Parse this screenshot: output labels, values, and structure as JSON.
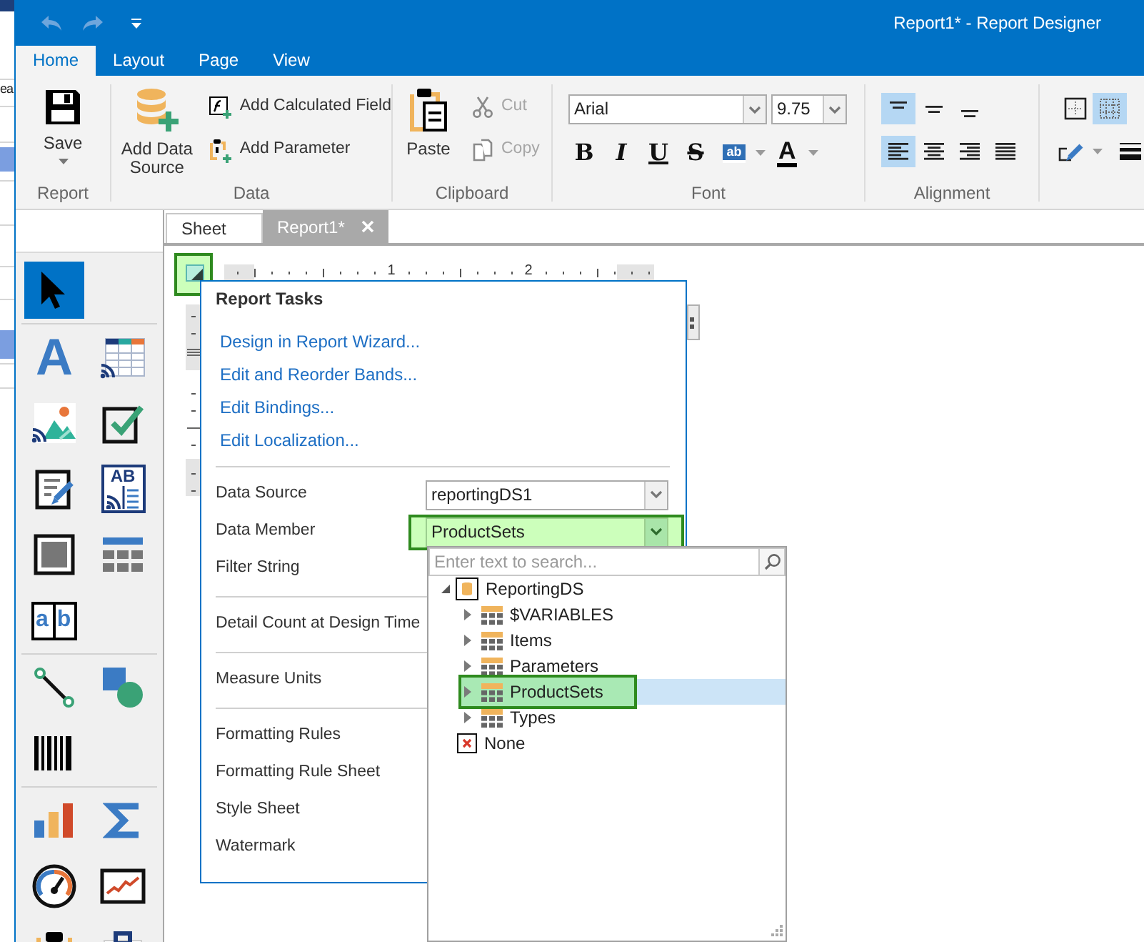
{
  "background_window": {
    "text": "ea"
  },
  "window": {
    "title": "Report1* - Report Designer"
  },
  "quick_access": [
    {
      "kind": "undo",
      "disabled": true
    },
    {
      "kind": "redo",
      "disabled": true
    },
    {
      "kind": "customize",
      "disabled": false
    }
  ],
  "ribbon_tabs": [
    {
      "label": "Home",
      "selected": true
    },
    {
      "label": "Layout",
      "selected": false
    },
    {
      "label": "Page",
      "selected": false
    },
    {
      "label": "View",
      "selected": false
    }
  ],
  "ribbon_groups": [
    {
      "kind": "commands",
      "label": "Report",
      "large": [
        {
          "kind": "save",
          "label": "Save",
          "dropdown": true
        }
      ]
    },
    {
      "kind": "commands",
      "label": "Data",
      "large": [
        {
          "kind": "datasource",
          "label": "Add Data Source",
          "dropdown": false
        }
      ],
      "small": [
        {
          "kind": "function",
          "label": "Add Calculated Field",
          "disabled": false
        },
        {
          "kind": "parameter",
          "label": "Add Parameter",
          "disabled": false
        }
      ]
    },
    {
      "kind": "commands",
      "label": "Clipboard",
      "large": [
        {
          "kind": "paste",
          "label": "Paste",
          "dropdown": false
        }
      ],
      "small": [
        {
          "kind": "cut",
          "label": "Cut",
          "disabled": true
        },
        {
          "kind": "copy",
          "label": "Copy",
          "disabled": true
        }
      ]
    },
    {
      "kind": "font",
      "label": "Font",
      "font_name": "Arial",
      "font_size": "9.75",
      "styles": [
        {
          "label": "B",
          "selected": false
        },
        {
          "label": "I",
          "selected": false
        },
        {
          "label": "U",
          "selected": false
        },
        {
          "label": "S",
          "selected": false
        }
      ],
      "highlight_color": {
        "label": "ab"
      },
      "font_color": {
        "label": "A"
      }
    },
    {
      "kind": "alignment",
      "label": "Alignment",
      "vertical": [
        {
          "selected": true
        },
        {
          "selected": false
        },
        {
          "selected": false
        }
      ],
      "horizontal": [
        {
          "selected": true
        },
        {
          "selected": false
        },
        {
          "selected": false
        },
        {
          "selected": false
        }
      ]
    },
    {
      "kind": "borders",
      "buttons": [
        {
          "selected": false
        },
        {
          "selected": true
        }
      ]
    }
  ],
  "toolbox": {
    "sections": [
      {
        "tools": [
          {
            "kind": "pointer",
            "selected": true
          }
        ]
      },
      {
        "tools": [
          {
            "kind": "label",
            "glyph": "A",
            "selected": false
          },
          {
            "kind": "table",
            "selected": false
          },
          {
            "kind": "picture",
            "selected": false
          },
          {
            "kind": "checkbox",
            "selected": false
          },
          {
            "kind": "richtext",
            "selected": false
          },
          {
            "kind": "columns",
            "glyph": "AB",
            "selected": false
          },
          {
            "kind": "panel",
            "selected": false
          },
          {
            "kind": "grid",
            "selected": false
          },
          {
            "kind": "charcomb",
            "glyph": "ab",
            "selected": false
          }
        ]
      },
      {
        "tools": [
          {
            "kind": "line",
            "selected": false
          },
          {
            "kind": "shape",
            "selected": false
          },
          {
            "kind": "barcode",
            "selected": false
          }
        ]
      },
      {
        "tools": [
          {
            "kind": "chart",
            "selected": false
          },
          {
            "kind": "summary",
            "selected": false
          },
          {
            "kind": "gauge",
            "selected": false
          },
          {
            "kind": "sparkline",
            "selected": false
          },
          {
            "kind": "clipboard",
            "selected": false
          },
          {
            "kind": "case",
            "selected": false
          }
        ]
      }
    ]
  },
  "document_tabs": [
    {
      "label": "Sheet",
      "selected": false,
      "closable": false
    },
    {
      "label": "Report1*",
      "selected": true,
      "closable": true
    }
  ],
  "smart_tag": {
    "highlighted": true
  },
  "ruler": {
    "labels": [
      "1",
      "2"
    ]
  },
  "report_tasks": {
    "title": "Report Tasks",
    "links": [
      "Design in Report Wizard...",
      "Edit and Reorder Bands...",
      "Edit Bindings...",
      "Edit Localization..."
    ],
    "sections": [
      {
        "rows": [
          {
            "kind": "combo",
            "label": "Data Source",
            "value": "reportingDS1",
            "highlighted": false
          },
          {
            "kind": "combo",
            "label": "Data Member",
            "value": "ProductSets",
            "highlighted": true
          },
          {
            "kind": "label",
            "label": "Filter String"
          }
        ]
      },
      {
        "rows": [
          {
            "kind": "label",
            "label": "Detail Count at Design Time"
          }
        ]
      },
      {
        "rows": [
          {
            "kind": "label",
            "label": "Measure Units"
          }
        ]
      },
      {
        "rows": [
          {
            "kind": "label",
            "label": "Formatting Rules"
          },
          {
            "kind": "label",
            "label": "Formatting Rule Sheet"
          },
          {
            "kind": "label",
            "label": "Style Sheet"
          },
          {
            "kind": "label",
            "label": "Watermark"
          }
        ]
      }
    ]
  },
  "data_member_dropdown": {
    "search": {
      "placeholder": "Enter text to search..."
    },
    "tree": [
      {
        "kind": "datasource",
        "label": "ReportingDS",
        "expanded": true,
        "selected": false,
        "highlighted": false,
        "children": [
          {
            "kind": "table",
            "label": "$VARIABLES",
            "expanded": false,
            "selected": false,
            "highlighted": false
          },
          {
            "kind": "table",
            "label": "Items",
            "expanded": false,
            "selected": false,
            "highlighted": false
          },
          {
            "kind": "table",
            "label": "Parameters",
            "expanded": false,
            "selected": false,
            "highlighted": false
          },
          {
            "kind": "table",
            "label": "ProductSets",
            "expanded": false,
            "selected": true,
            "highlighted": true
          },
          {
            "kind": "table",
            "label": "Types",
            "expanded": false,
            "selected": false,
            "highlighted": false
          }
        ]
      },
      {
        "kind": "none",
        "label": "None",
        "selected": false,
        "highlighted": false
      }
    ]
  }
}
